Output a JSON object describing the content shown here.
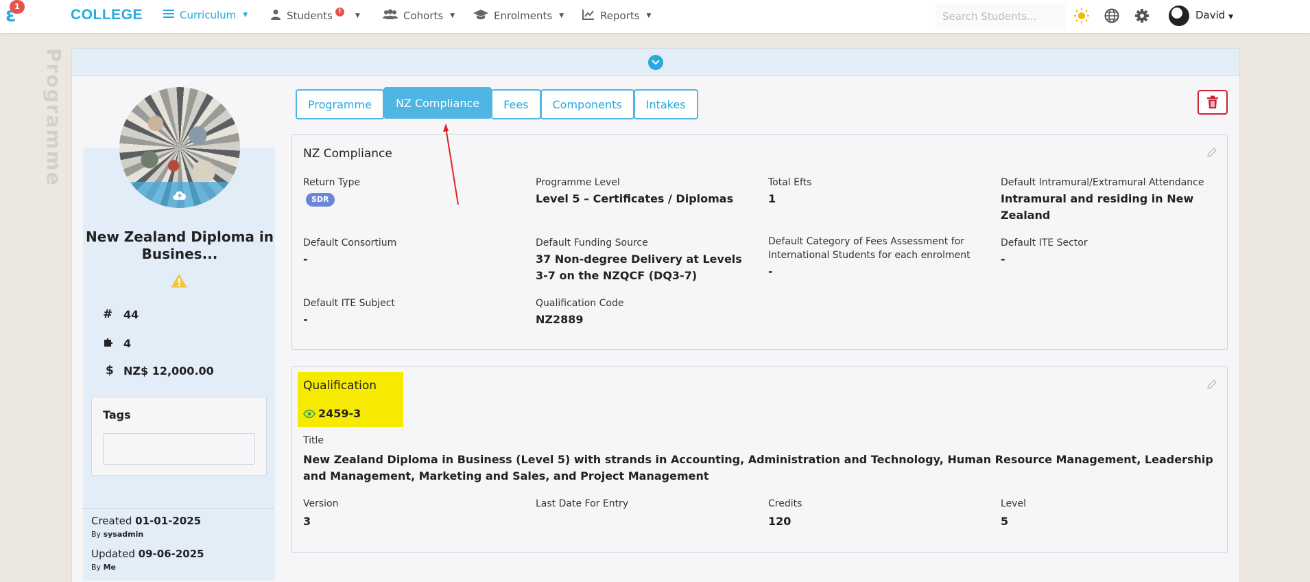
{
  "nav": {
    "logo_letter": "ε",
    "logo_badge": "1",
    "brand": "COLLEGE",
    "items": [
      {
        "label": "Curriculum",
        "icon": "list-icon",
        "active": true
      },
      {
        "label": "Students",
        "icon": "person-icon",
        "badge": "!"
      },
      {
        "label": "Cohorts",
        "icon": "group-icon"
      },
      {
        "label": "Enrolments",
        "icon": "graduation-cap-icon"
      },
      {
        "label": "Reports",
        "icon": "line-chart-icon"
      }
    ],
    "search_placeholder": "Search Students...",
    "user": "David"
  },
  "side_label": "Programme",
  "sidebar": {
    "title": "New Zealand Diploma in Busines...",
    "stats": [
      {
        "icon": "hash-icon",
        "value": "44"
      },
      {
        "icon": "puzzle-icon",
        "value": "4"
      },
      {
        "icon": "dollar-icon",
        "value": "NZ$ 12,000.00"
      }
    ],
    "tags_title": "Tags",
    "created_label": "Created",
    "created_date": "01-01-2025",
    "created_by_label": "By",
    "created_by": "sysadmin",
    "updated_label": "Updated",
    "updated_date": "09-06-2025",
    "updated_by_label": "By",
    "updated_by": "Me"
  },
  "tabs": [
    "Programme",
    "NZ Compliance",
    "Fees",
    "Components",
    "Intakes"
  ],
  "compliance": {
    "title": "NZ Compliance",
    "return_type_label": "Return Type",
    "return_type": "SDR",
    "programme_level_label": "Programme Level",
    "programme_level": "Level 5 – Certificates / Diplomas",
    "total_efts_label": "Total Efts",
    "total_efts": "1",
    "attendance_label": "Default Intramural/Extramural Attendance",
    "attendance": "Intramural and residing in New Zealand",
    "consortium_label": "Default Consortium",
    "consortium": "-",
    "funding_label": "Default Funding Source",
    "funding": "37 Non-degree Delivery at Levels 3-7 on the NZQCF (DQ3-7)",
    "fees_category_label": "Default Category of Fees Assessment for International Students for each enrolment",
    "fees_category": "-",
    "ite_sector_label": "Default ITE Sector",
    "ite_sector": "-",
    "ite_subject_label": "Default ITE Subject",
    "ite_subject": "-",
    "qual_code_label": "Qualification Code",
    "qual_code": "NZ2889"
  },
  "qualification": {
    "title": "Qualification",
    "code": "2459-3",
    "title_label": "Title",
    "full_title": "New Zealand Diploma in Business (Level 5) with strands in Accounting, Administration and Technology, Human Resource Management, Leadership and Management, Marketing and Sales, and Project Management",
    "version_label": "Version",
    "version": "3",
    "last_date_label": "Last Date For Entry",
    "last_date": "",
    "credits_label": "Credits",
    "credits": "120",
    "level_label": "Level",
    "level": "5"
  },
  "colors": {
    "accent": "#28a9df",
    "danger": "#c82333",
    "highlight": "#f5ea00",
    "badge": "#e9534d"
  }
}
